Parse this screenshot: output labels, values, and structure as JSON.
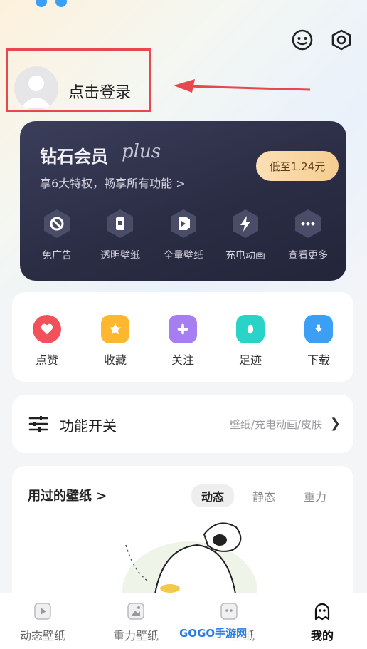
{
  "header": {
    "face_icon": "smiley-face-icon",
    "settings_icon": "hexagon-settings-icon"
  },
  "login": {
    "label": "点击登录"
  },
  "vip": {
    "title": "钻石会员",
    "plus": "plus",
    "subtitle": "享6大特权，畅享所有功能 >",
    "price_button": "低至1.24元",
    "perks": [
      {
        "label": "免广告",
        "icon": "no-ads-icon"
      },
      {
        "label": "透明壁纸",
        "icon": "transparent-wallpaper-icon"
      },
      {
        "label": "全量壁纸",
        "icon": "full-wallpaper-icon"
      },
      {
        "label": "充电动画",
        "icon": "charging-animation-icon"
      },
      {
        "label": "查看更多",
        "icon": "more-dots-icon"
      }
    ]
  },
  "quick_actions": [
    {
      "label": "点赞",
      "icon": "heart-icon",
      "color": "#f2505a"
    },
    {
      "label": "收藏",
      "icon": "star-icon",
      "color": "#ffb730"
    },
    {
      "label": "关注",
      "icon": "plus-icon",
      "color": "#a77ef2"
    },
    {
      "label": "足迹",
      "icon": "footprint-icon",
      "color": "#29d3c7"
    },
    {
      "label": "下载",
      "icon": "download-folder-icon",
      "color": "#3a9ff5"
    }
  ],
  "function_switch": {
    "title": "功能开关",
    "desc": "壁纸/充电动画/皮肤"
  },
  "used_wallpapers": {
    "title": "用过的壁纸 >",
    "tabs": [
      {
        "label": "动态",
        "active": true
      },
      {
        "label": "静态",
        "active": false
      },
      {
        "label": "重力",
        "active": false
      }
    ]
  },
  "bottom_nav": [
    {
      "label": "动态壁纸",
      "icon": "play-tile-icon",
      "active": false
    },
    {
      "label": "重力壁纸",
      "icon": "gravity-tile-icon",
      "active": false
    },
    {
      "label": "壁纸",
      "icon": "wallpaper-tile-icon",
      "active": false
    },
    {
      "label": "我的",
      "icon": "ghost-face-icon",
      "active": true
    }
  ],
  "watermark": "GOGO手游网"
}
